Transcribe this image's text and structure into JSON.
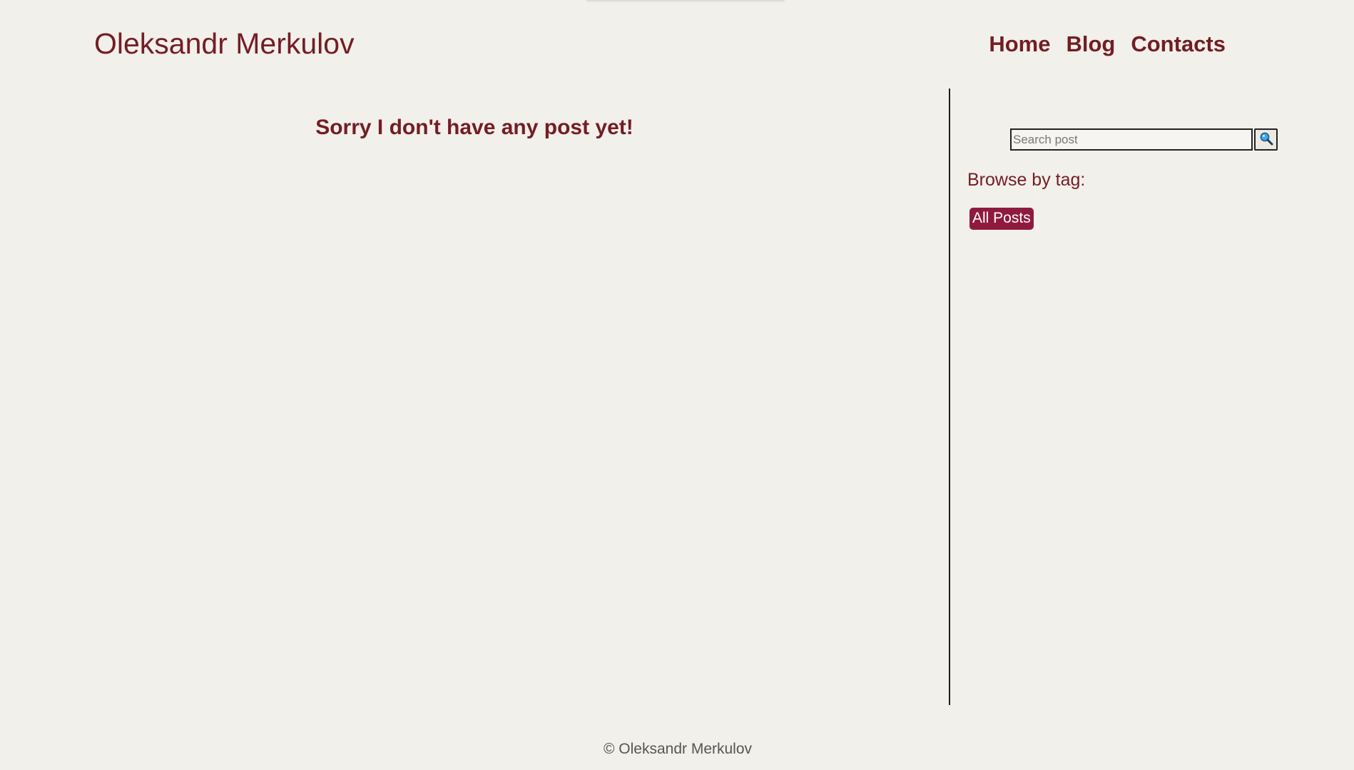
{
  "header": {
    "site_title": "Oleksandr Merkulov",
    "nav": [
      {
        "label": "Home"
      },
      {
        "label": "Blog"
      },
      {
        "label": "Contacts"
      }
    ]
  },
  "main": {
    "empty_message": "Sorry I don't have any post yet!"
  },
  "sidebar": {
    "search": {
      "placeholder": "Search post",
      "value": "",
      "button_icon": "search-icon"
    },
    "browse_label": "Browse by tag:",
    "tags": [
      {
        "label": "All Posts"
      }
    ]
  },
  "footer": {
    "copyright": "© Oleksandr Merkulov"
  },
  "colors": {
    "background": "#f2f0eb",
    "accent": "#731d24",
    "tag_background": "#8f1a40"
  }
}
